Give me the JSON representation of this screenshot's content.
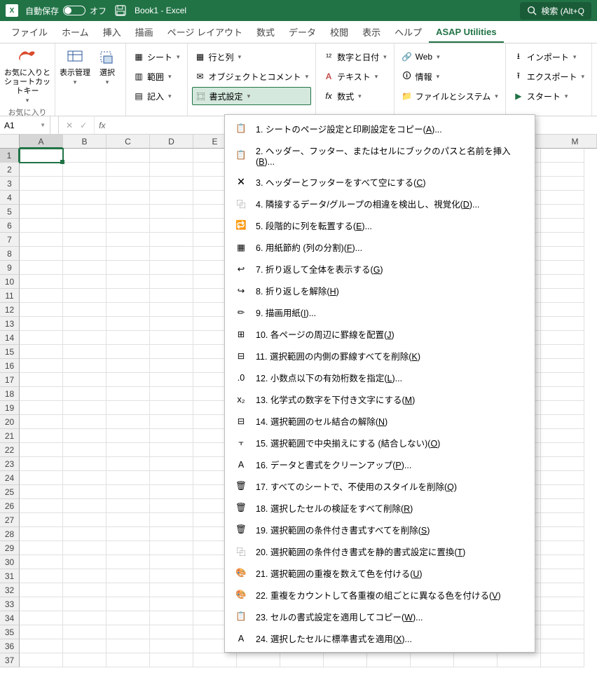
{
  "titlebar": {
    "autosave_label": "自動保存",
    "autosave_state": "オフ",
    "title": "Book1 - Excel",
    "search_placeholder": "検索 (Alt+Q"
  },
  "tabs": {
    "file": "ファイル",
    "home": "ホーム",
    "insert": "挿入",
    "draw": "描画",
    "page_layout": "ページ レイアウト",
    "formulas": "数式",
    "data": "データ",
    "review": "校閲",
    "view": "表示",
    "help": "ヘルプ",
    "asap": "ASAP Utilities"
  },
  "ribbon": {
    "favorites": {
      "btn": "お気に入りとショートカットキー",
      "group": "お気に入り"
    },
    "view_mgmt": "表示管理",
    "select": "選択",
    "sheet": "シート",
    "range": "範囲",
    "symbols": "記入",
    "row_col": "行と列",
    "obj_comment": "オブジェクトとコメント",
    "format": "書式設定",
    "num_date": "数字と日付",
    "text": "テキスト",
    "fx": "数式",
    "web": "Web",
    "info": "情報",
    "file_sys": "ファイルとシステム",
    "import": "インポート",
    "export": "エクスポート",
    "start": "スタート"
  },
  "namebox": {
    "value": "A1"
  },
  "columns": [
    "A",
    "B",
    "C",
    "D",
    "E",
    "M"
  ],
  "dropdown": {
    "items": [
      {
        "n": "1",
        "t": "シートのページ設定と印刷設定をコピー(",
        "k": "A",
        "s": ")..."
      },
      {
        "n": "2",
        "t": "ヘッダー、フッター、またはセルにブックのパスと名前を挿入(",
        "k": "B",
        "s": ")..."
      },
      {
        "n": "3",
        "t": "ヘッダーとフッターをすべて空にする(",
        "k": "C",
        "s": ")"
      },
      {
        "n": "4",
        "t": "隣接するデータ/グループの相違を検出し、視覚化(",
        "k": "D",
        "s": ")..."
      },
      {
        "n": "5",
        "t": "段階的に列を転置する(",
        "k": "E",
        "s": ")..."
      },
      {
        "n": "6",
        "t": "用紙節約 (列の分割)(",
        "k": "F",
        "s": ")..."
      },
      {
        "n": "7",
        "t": "折り返して全体を表示する(",
        "k": "G",
        "s": ")"
      },
      {
        "n": "8",
        "t": "折り返しを解除(",
        "k": "H",
        "s": ")"
      },
      {
        "n": "9",
        "t": "描画用紙(",
        "k": "I",
        "s": ")..."
      },
      {
        "n": "10",
        "t": "各ページの周辺に罫線を配置(",
        "k": "J",
        "s": ")"
      },
      {
        "n": "11",
        "t": "選択範囲の内側の罫線すべてを削除(",
        "k": "K",
        "s": ")"
      },
      {
        "n": "12",
        "t": "小数点以下の有効桁数を指定(",
        "k": "L",
        "s": ")..."
      },
      {
        "n": "13",
        "t": "化学式の数字を下付き文字にする(",
        "k": "M",
        "s": ")"
      },
      {
        "n": "14",
        "t": "選択範囲のセル結合の解除(",
        "k": "N",
        "s": ")"
      },
      {
        "n": "15",
        "t": "選択範囲で中央揃えにする (結合しない)(",
        "k": "O",
        "s": ")"
      },
      {
        "n": "16",
        "t": "データと書式をクリーンアップ(",
        "k": "P",
        "s": ")..."
      },
      {
        "n": "17",
        "t": "すべてのシートで、不使用のスタイルを削除(",
        "k": "Q",
        "s": ")"
      },
      {
        "n": "18",
        "t": "選択したセルの検証をすべて削除(",
        "k": "R",
        "s": ")"
      },
      {
        "n": "19",
        "t": "選択範囲の条件付き書式すべてを削除(",
        "k": "S",
        "s": ")"
      },
      {
        "n": "20",
        "t": "選択範囲の条件付き書式を静的書式設定に置換(",
        "k": "T",
        "s": ")"
      },
      {
        "n": "21",
        "t": "選択範囲の重複を数えて色を付ける(",
        "k": "U",
        "s": ")"
      },
      {
        "n": "22",
        "t": "重複をカウントして各重複の組ごとに異なる色を付ける(",
        "k": "V",
        "s": ")"
      },
      {
        "n": "23",
        "t": "セルの書式設定を適用してコピー(",
        "k": "W",
        "s": ")..."
      },
      {
        "n": "24",
        "t": "選択したセルに標準書式を適用(",
        "k": "X",
        "s": ")..."
      }
    ]
  }
}
